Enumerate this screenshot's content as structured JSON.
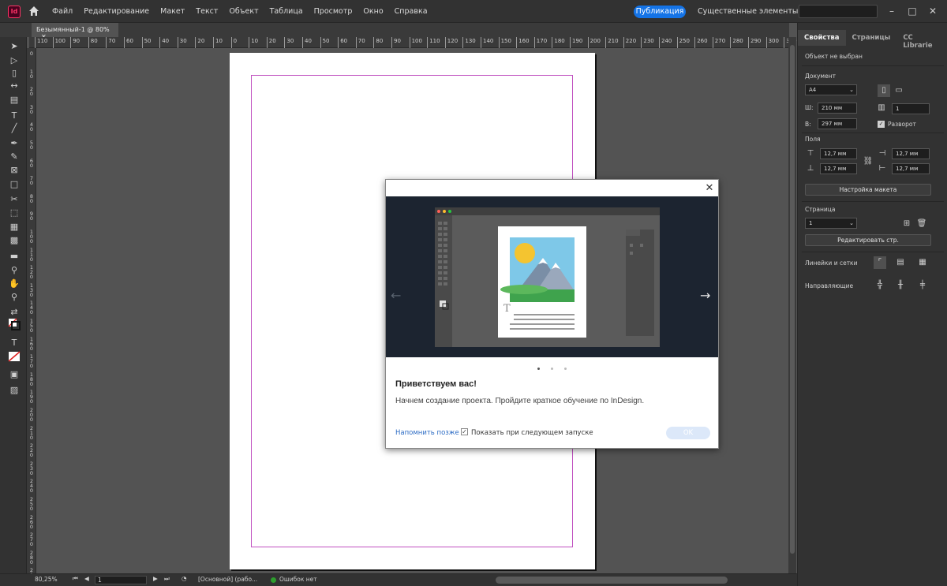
{
  "menubar": {
    "app_logo": "Id",
    "items": [
      "Файл",
      "Редактирование",
      "Макет",
      "Текст",
      "Объект",
      "Таблица",
      "Просмотр",
      "Окно",
      "Справка"
    ],
    "publish_label": "Публикация",
    "workspace_label": "Существенные элементы",
    "minimize": "–",
    "maximize": "□",
    "close": "✕"
  },
  "document": {
    "tab_label": "Безымянный-1 @ 80%",
    "tab_close": "✕",
    "ruler_h": [
      "110",
      "100",
      "90",
      "80",
      "70",
      "60",
      "50",
      "40",
      "30",
      "20",
      "10",
      "0",
      "10",
      "20",
      "30",
      "40",
      "50",
      "60",
      "70",
      "80",
      "90",
      "100",
      "110",
      "120",
      "130",
      "140",
      "150",
      "160",
      "170",
      "180",
      "190",
      "200",
      "210",
      "220",
      "230",
      "240",
      "250",
      "260",
      "270",
      "280",
      "290",
      "300",
      "310"
    ],
    "ruler_v": [
      "0",
      "1 0",
      "2 0",
      "3 0",
      "4 0",
      "5 0",
      "6 0",
      "7 0",
      "8 0",
      "9 0",
      "1 0 0",
      "1 1 0",
      "1 2 0",
      "1 3 0",
      "1 4 0",
      "1 5 0",
      "1 6 0",
      "1 7 0",
      "1 8 0",
      "1 9 0",
      "2 0 0",
      "2 1 0",
      "2 2 0",
      "2 3 0",
      "2 4 0",
      "2 5 0",
      "2 6 0",
      "2 7 0",
      "2 8 0",
      "2 9 0"
    ]
  },
  "toolbar": {
    "tools": [
      "selection-tool",
      "direct-selection-tool",
      "page-tool",
      "gap-tool",
      "content-collector-tool",
      "type-tool",
      "line-tool",
      "pen-tool",
      "pencil-tool",
      "rectangle-frame-tool",
      "rectangle-tool",
      "scissors-tool",
      "free-transform-tool",
      "gradient-swatch-tool",
      "gradient-feather-tool",
      "note-tool",
      "eyedropper-tool",
      "hand-tool",
      "zoom-tool"
    ]
  },
  "statusbar": {
    "zoom": "80,25%",
    "page": "1",
    "mode": "[Основной] (рабо...",
    "errors": "Ошибок нет"
  },
  "panel": {
    "tabs": [
      "Свойства",
      "Страницы",
      "CC Librarie"
    ],
    "no_selection": "Объект не выбран",
    "document_label": "Документ",
    "preset": "A4",
    "width_label": "Ш:",
    "width": "210 мм",
    "height_label": "В:",
    "height": "297 мм",
    "pages_count": "1",
    "spread_label": "Разворот",
    "margins_label": "Поля",
    "margin_top": "12,7 мм",
    "margin_bottom": "12,7 мм",
    "margin_left": "12,7 мм",
    "margin_right": "12,7 мм",
    "layout_button": "Настройка макета",
    "page_label": "Страница",
    "page_value": "1",
    "edit_page_button": "Редактировать стр.",
    "rulers_label": "Линейки и сетки",
    "guides_label": "Направляющие"
  },
  "dialog": {
    "close": "✕",
    "title": "Приветствуем вас!",
    "body": "Начнем создание проекта. Пройдите краткое обучение по InDesign.",
    "remind_later": "Напомнить позже",
    "show_next": "Показать при следующем запуске",
    "ok": "OK",
    "prev_arrow": "←",
    "next_arrow": "→",
    "type_glyph": "T",
    "checkbox_mark": "✓"
  },
  "colors": {
    "accent": "#1473e6",
    "margin_guide": "#c050c0",
    "banner_bg": "#1c2430"
  }
}
